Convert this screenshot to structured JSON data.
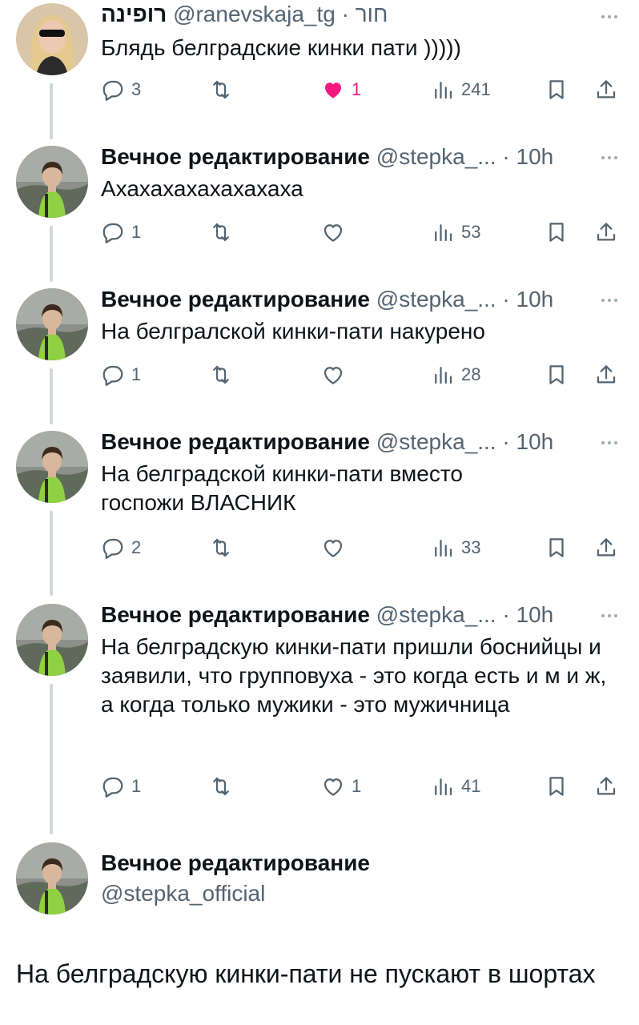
{
  "colors": {
    "accent_like": "#f91880",
    "muted": "#536471",
    "thread_line": "#cfd9de"
  },
  "tweets": [
    {
      "name": "רופינה",
      "handle": "@ranevskaja_tg",
      "sep": "·",
      "time": "חור",
      "text": "Блядь белградские кинки пати )))))",
      "replies": "3",
      "retweets": "",
      "likes": "1",
      "views": "241",
      "liked": true
    },
    {
      "name": "Вечное редактирование",
      "handle": "@stepka_...",
      "sep": "·",
      "time": "10h",
      "text": "Ахахахахахахахаха",
      "replies": "1",
      "retweets": "",
      "likes": "",
      "views": "53"
    },
    {
      "name": "Вечное редактирование",
      "handle": "@stepka_...",
      "sep": "·",
      "time": "10h",
      "text": "На белгралской кинки-пати накурено",
      "replies": "1",
      "retweets": "",
      "likes": "",
      "views": "28"
    },
    {
      "name": "Вечное редактирование",
      "handle": "@stepka_...",
      "sep": "·",
      "time": "10h",
      "text": "На белградской кинки-пати вместо госпожи ВЛАСНИК",
      "replies": "2",
      "retweets": "",
      "likes": "",
      "views": "33"
    },
    {
      "name": "Вечное редактирование",
      "handle": "@stepka_...",
      "sep": "·",
      "time": "10h",
      "text": "На белградскую кинки-пати пришли боснийцы и заявили, что групповуха - это когда есть и м и ж, а когда только мужики - это мужичница",
      "replies": "1",
      "retweets": "",
      "likes": "1",
      "views": "41"
    }
  ],
  "main_tweet": {
    "name": "Вечное редактирование",
    "handle": "@stepka_official",
    "text": "На белградскую кинки-пати не пускают в шортах"
  },
  "icons": {
    "reply": "reply-icon",
    "retweet": "retweet-icon",
    "like": "heart-icon",
    "views": "views-icon",
    "bookmark": "bookmark-icon",
    "share": "share-icon",
    "more": "more-icon"
  }
}
